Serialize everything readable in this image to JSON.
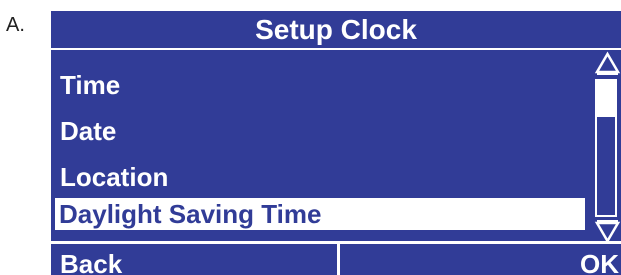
{
  "figure_label": "A.",
  "screen": {
    "title": "Setup Clock",
    "menu": [
      {
        "label": "Time",
        "selected": false
      },
      {
        "label": "Date",
        "selected": false
      },
      {
        "label": "Location",
        "selected": false
      },
      {
        "label": "Daylight Saving Time",
        "selected": true
      }
    ],
    "scrollbar": {
      "up_icon": "triangle-up-icon",
      "down_icon": "triangle-down-icon",
      "thumb_fraction": 0.27
    },
    "softkeys": {
      "left_label": "Back",
      "right_label": "OK"
    }
  },
  "colors": {
    "screen_background": "#313c97",
    "foreground": "#ffffff",
    "selected_text": "#313c97"
  }
}
